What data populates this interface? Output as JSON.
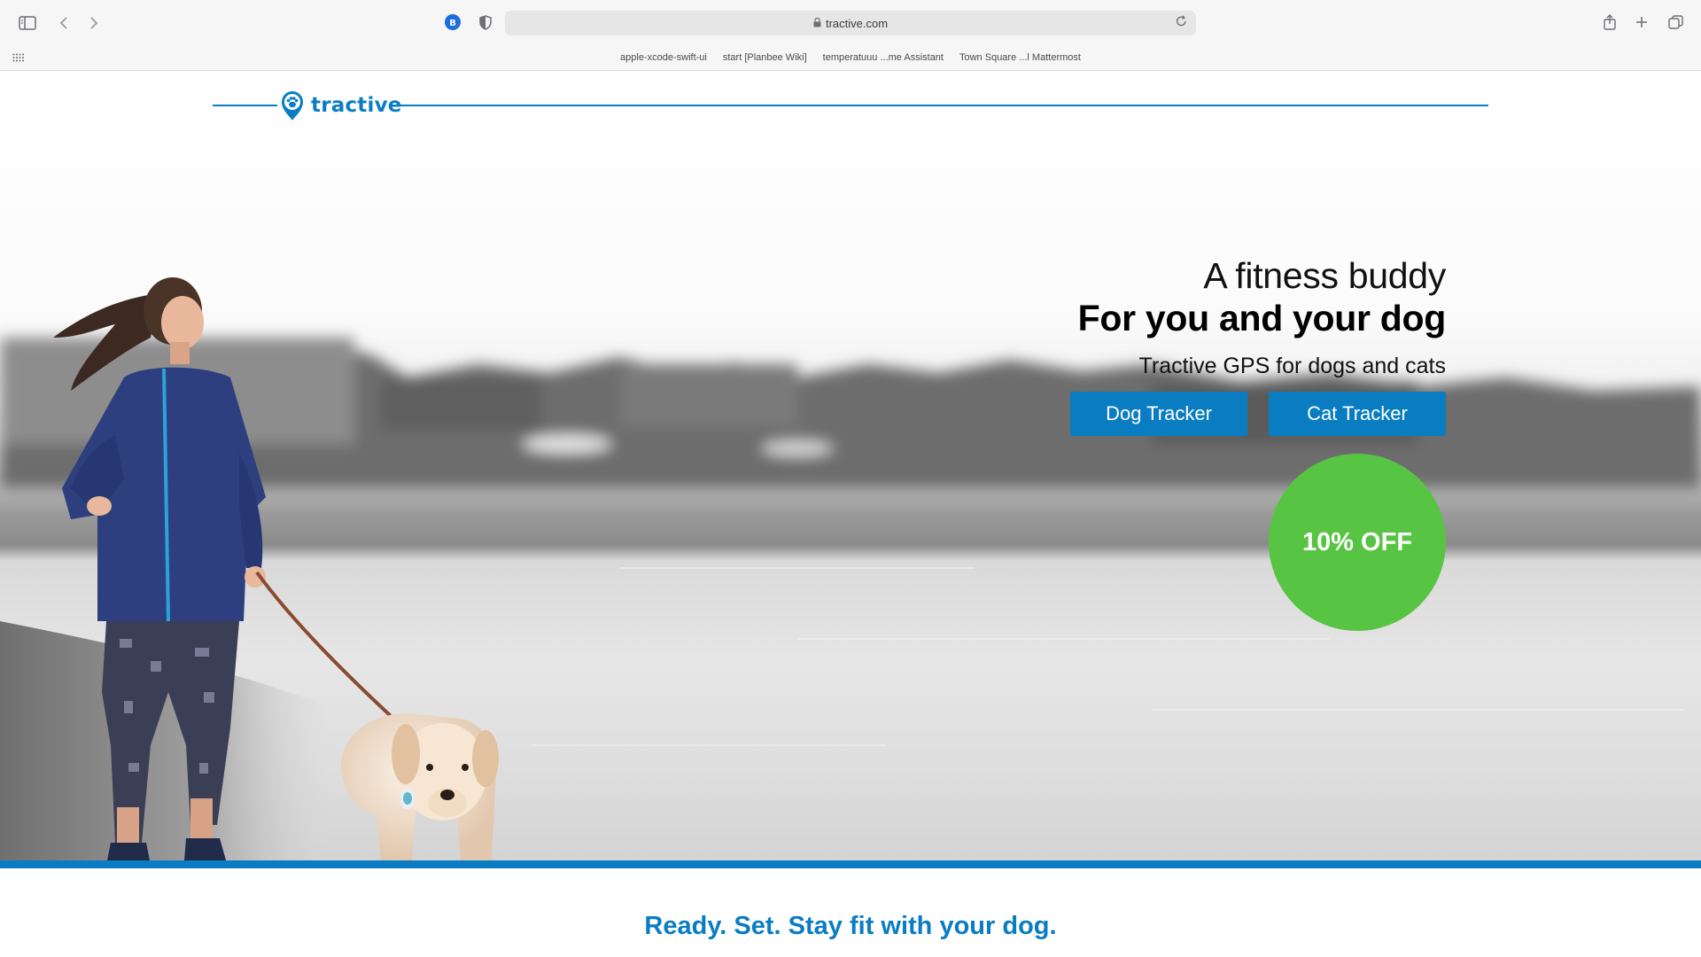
{
  "browser": {
    "url": "tractive.com",
    "icons": {
      "sidebar": "sidebar-icon",
      "back": "chevron-left-icon",
      "forward": "chevron-right-icon",
      "extension": "bitwarden-icon",
      "privacy": "shield-icon",
      "lock": "lock-icon",
      "reload": "reload-icon",
      "share": "share-icon",
      "new_tab": "plus-icon",
      "tabs": "tab-overview-icon",
      "bookmarks_grid": "grid-icon"
    },
    "extension_badge": "B",
    "bookmarks": [
      "apple-xcode-swift-ui",
      "start [Planbee Wiki]",
      "temperatuuu ...me Assistant",
      "Town Square ...l Mattermost"
    ]
  },
  "header": {
    "logo_text": "tractive",
    "brand_color": "#0a7dc2"
  },
  "hero": {
    "headline_light": "A fitness buddy",
    "headline_bold": "For you and your dog",
    "subheadline": "Tractive GPS for dogs and cats",
    "buttons": [
      {
        "label": "Dog Tracker"
      },
      {
        "label": "Cat Tracker"
      }
    ],
    "offer_badge": "10% OFF",
    "offer_color": "#57c443"
  },
  "section": {
    "tagline": "Ready. Set. Stay fit with your dog."
  }
}
